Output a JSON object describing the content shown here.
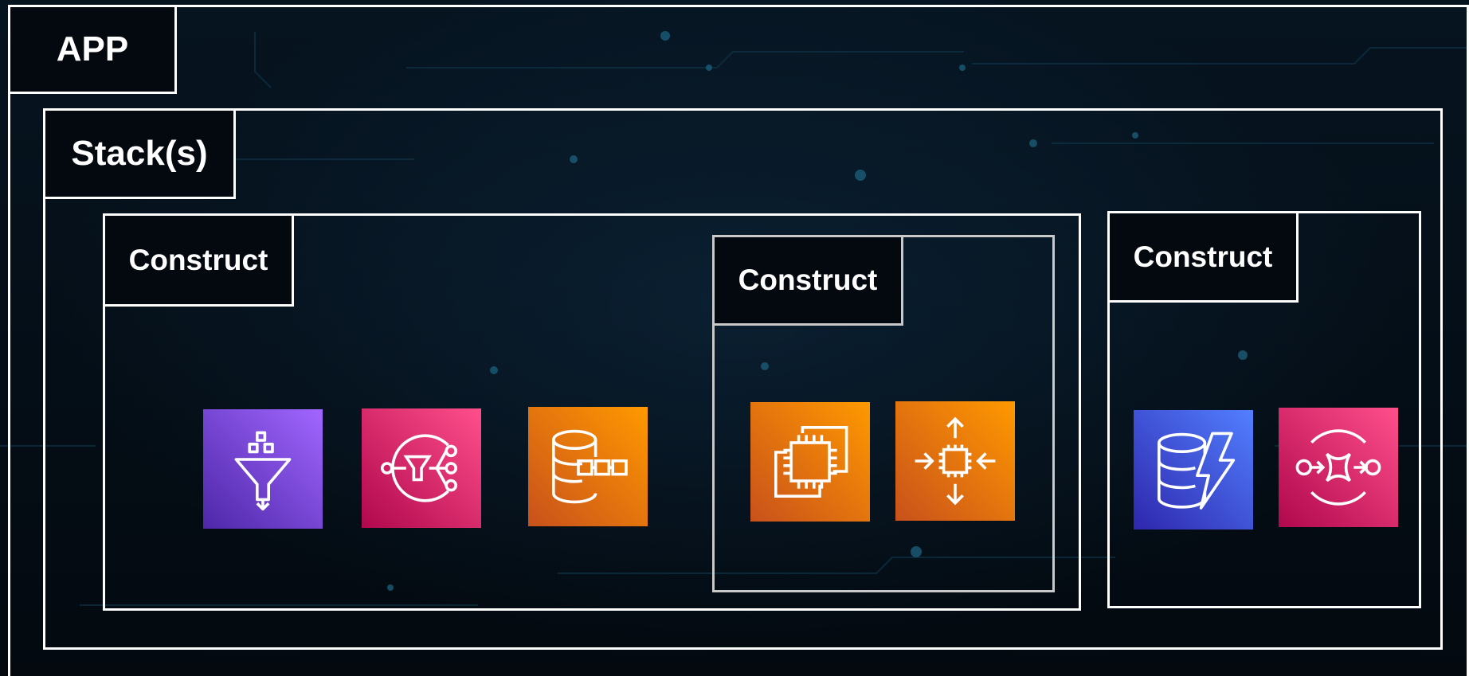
{
  "app": {
    "label": "APP"
  },
  "stack": {
    "label": "Stack(s)"
  },
  "constructs": [
    {
      "label": "Construct",
      "services": [
        "funnel-icon",
        "notification-filter-icon",
        "database-chain-icon"
      ]
    },
    {
      "label": "Construct",
      "services": [
        "instances-icon",
        "autoscaling-icon"
      ]
    },
    {
      "label": "Construct",
      "services": [
        "dynamodb-icon",
        "queue-icon"
      ]
    }
  ],
  "colors": {
    "purple": "#8c4fff",
    "pink": "#e7157b",
    "orange": "#ed7100",
    "blue": "#3f5ce8",
    "border": "#ffffff",
    "inner_border": "#c9c9c9",
    "background": "#050d15"
  }
}
